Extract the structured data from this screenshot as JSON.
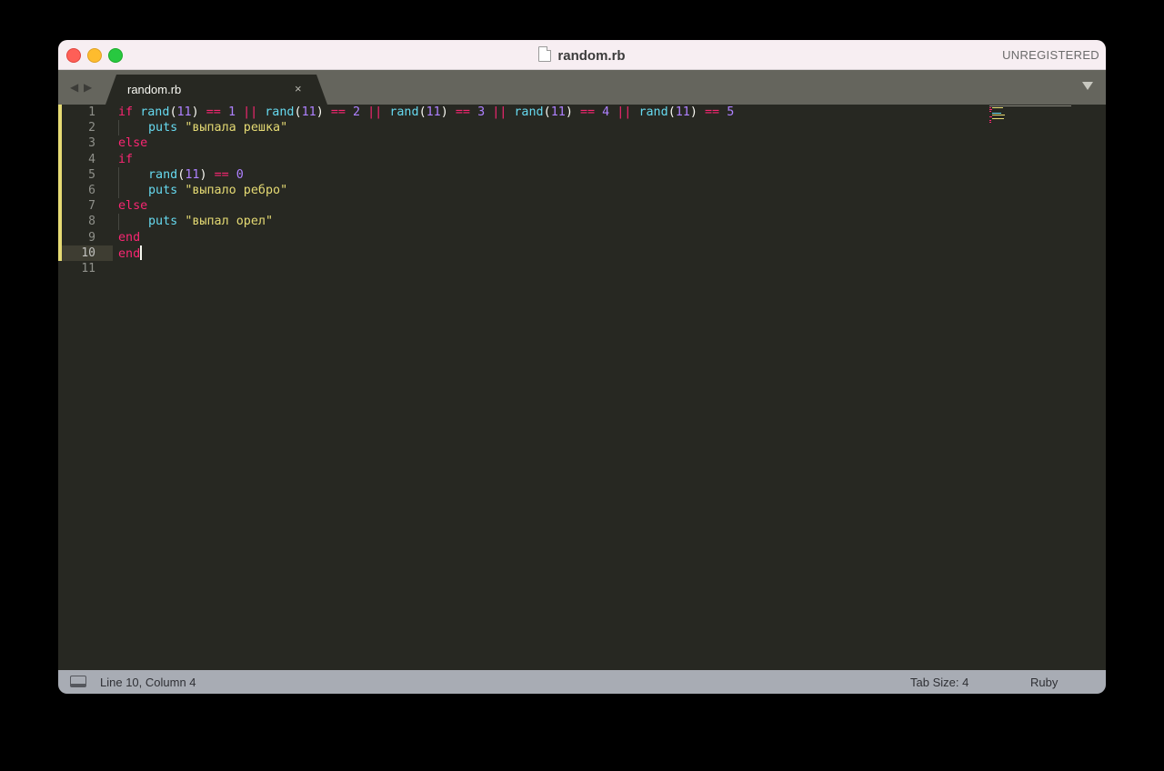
{
  "window": {
    "title": "random.rb",
    "badge": "UNREGISTERED"
  },
  "tabs": [
    {
      "label": "random.rb",
      "close": "×"
    }
  ],
  "editor": {
    "line_numbers": [
      "1",
      "2",
      "3",
      "4",
      "5",
      "6",
      "7",
      "8",
      "9",
      "10",
      "11"
    ],
    "active_line": 10,
    "code": [
      "if rand(11) == 1 || rand(11) == 2 || rand(11) == 3 || rand(11) == 4 || rand(11) == 5",
      "    puts \"выпала решка\"",
      "else",
      "if",
      "    rand(11) == 0",
      "    puts \"выпало ребро\"",
      "else",
      "    puts \"выпал орел\"",
      "end",
      "end",
      ""
    ],
    "tokens": {
      "t1": [
        "if",
        "rand",
        "(",
        "11",
        ")",
        "==",
        "1",
        "||",
        "rand",
        "(",
        "11",
        ")",
        "==",
        "2",
        "||",
        "rand",
        "(",
        "11",
        ")",
        "==",
        "3",
        "||",
        "rand",
        "(",
        "11",
        ")",
        "==",
        "4",
        "||",
        "rand",
        "(",
        "11",
        ")",
        "==",
        "5"
      ],
      "puts": "puts",
      "s1": "\"выпала решка\"",
      "s2": "\"выпало ребро\"",
      "s3": "\"выпал орел\"",
      "else": "else",
      "if": "if",
      "end": "end",
      "rand": "rand",
      "lp": "(",
      "rp": ")",
      "n11": "11",
      "eq": "==",
      "zero": "0",
      "en": "en",
      "d": "d"
    }
  },
  "status": {
    "position": "Line 10, Column 4",
    "tab_size": "Tab Size: 4",
    "syntax": "Ruby"
  },
  "colors": {
    "bg": "#272822",
    "keyword": "#f92672",
    "function": "#66d9ef",
    "number": "#ae81ff",
    "string": "#e6db74",
    "text": "#f8f8f2"
  },
  "icons": [
    "document-icon",
    "back-arrow-icon",
    "forward-arrow-icon",
    "close-icon",
    "dropdown-arrow-icon",
    "panel-toggle-icon"
  ]
}
